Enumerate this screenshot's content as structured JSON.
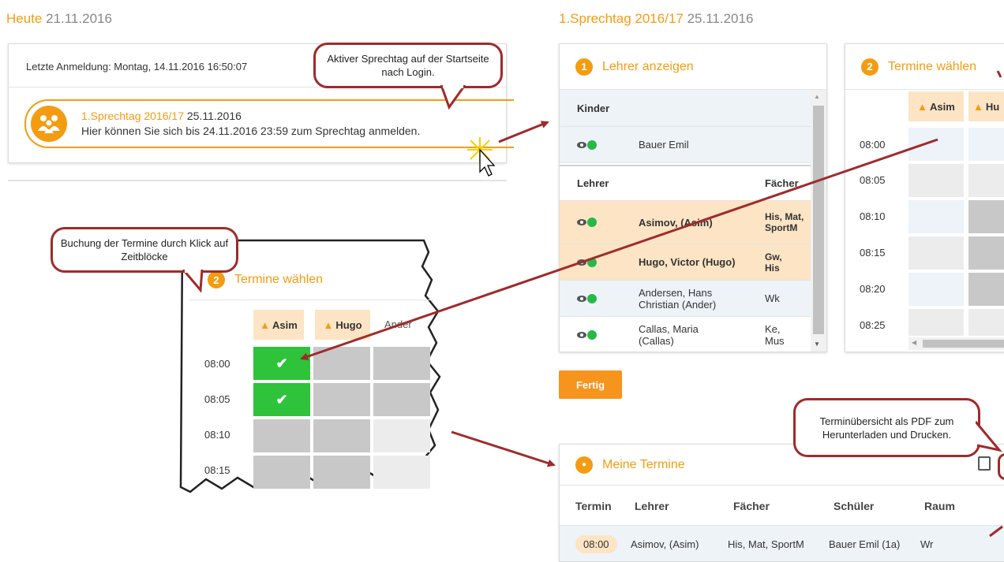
{
  "left": {
    "heute_label": "Heute",
    "heute_date": "21.11.2016",
    "last_login": "Letzte Anmeldung: Montag, 14.11.2016 16:50:07",
    "sprechtag_title": "1.Sprechtag 2016/17",
    "sprechtag_date": "25.11.2016",
    "sprechtag_info": "Hier können Sie sich bis 24.11.2016 23:59 zum Sprechtag anmelden."
  },
  "callouts": {
    "aktiver": "Aktiver Sprechtag auf der Startseite nach Login.",
    "buchung": "Buchung der Termine durch Klick auf Zeitblöcke",
    "pdf": "Terminübersicht als PDF zum Herunterladen und Drucken."
  },
  "zoom": {
    "step": "2",
    "title": "Termine wählen",
    "cols": [
      "Asim",
      "Hugo",
      "Ander"
    ],
    "times": [
      "08:00",
      "08:05",
      "08:10",
      "08:15"
    ],
    "check": "✔"
  },
  "right": {
    "title": "1.Sprechtag 2016/17",
    "date": "25.11.2016",
    "lehrer_panel": {
      "step": "1",
      "title": "Lehrer anzeigen",
      "kinder_header": "Kinder",
      "kind": "Bauer Emil",
      "lehrer_header": "Lehrer",
      "faecher_header": "Fächer",
      "teachers": [
        {
          "name": "Asimov, (Asim)",
          "subjects": "His, Mat, SportM"
        },
        {
          "name": "Hugo, Victor (Hugo)",
          "subjects": "Gw, His"
        },
        {
          "name": "Andersen, Hans Christian (Ander)",
          "subjects": "Wk"
        },
        {
          "name": "Callas, Maria (Callas)",
          "subjects": "Ke, Mus"
        }
      ]
    },
    "termine_panel": {
      "step": "2",
      "title": "Termine wählen",
      "cols": [
        "Asim",
        "Hu"
      ],
      "times": [
        "08:00",
        "08:05",
        "08:10",
        "08:15",
        "08:20",
        "08:25"
      ]
    },
    "fertig": "Fertig",
    "meine": {
      "title": "Meine Termine",
      "headers": [
        "Termin",
        "Lehrer",
        "Fächer",
        "Schüler",
        "Raum"
      ],
      "row": {
        "time": "08:00",
        "lehrer": "Asimov, (Asim)",
        "faecher": "His, Mat, SportM",
        "schueler": "Bauer Emil (1a)",
        "raum": "Wr"
      }
    }
  },
  "colors": {
    "accent": "#f39c12",
    "callout_border": "#a02a2a",
    "booked": "#2ec33a"
  }
}
